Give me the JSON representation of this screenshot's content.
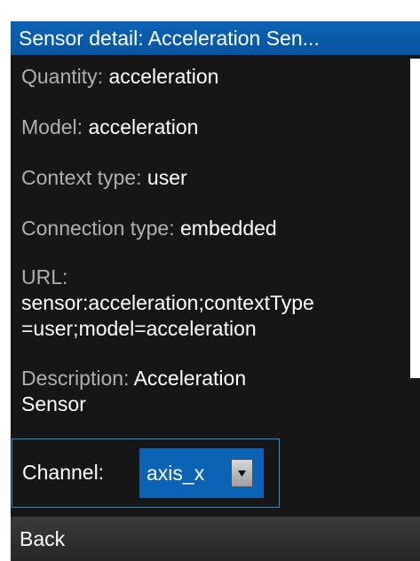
{
  "header": {
    "title": "Sensor detail: Acceleration Sen..."
  },
  "details": {
    "quantity_label": "Quantity:",
    "quantity_value": "acceleration",
    "model_label": "Model:",
    "model_value": "acceleration",
    "context_type_label": "Context type:",
    "context_type_value": "user",
    "connection_type_label": "Connection type:",
    "connection_type_value": "embedded",
    "url_label": "URL:",
    "url_value_line1": "sensor:acceleration;contextType",
    "url_value_line2": "=user;model=acceleration",
    "description_label": "Description:",
    "description_value_line1": "Acceleration",
    "description_value_line2": "Sensor"
  },
  "channel": {
    "label": "Channel:",
    "selected": "axis_x"
  },
  "footer": {
    "back_label": "Back"
  },
  "colors": {
    "accent": "#0a63b4",
    "background": "#161616",
    "label_text": "#b0b0b0",
    "value_text": "#ffffff",
    "focus_border": "#2a8fd8"
  },
  "icons": {
    "select_arrow": "chevron-down-icon"
  }
}
